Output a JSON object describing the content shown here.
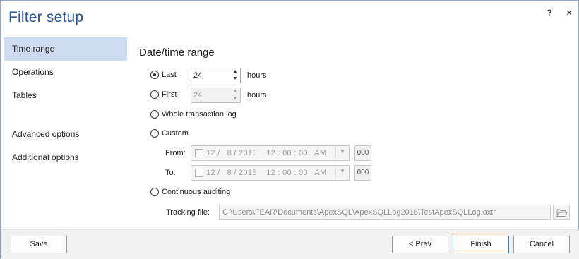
{
  "window": {
    "title": "Filter setup",
    "help_label": "?",
    "close_label": "×"
  },
  "sidebar": {
    "items": [
      {
        "label": "Time range",
        "active": true
      },
      {
        "label": "Operations"
      },
      {
        "label": "Tables"
      },
      {
        "label": "Advanced options"
      },
      {
        "label": "Additional options"
      }
    ]
  },
  "main": {
    "section_title": "Date/time range",
    "last": {
      "label": "Last",
      "value": "24",
      "unit": "hours",
      "selected": true
    },
    "first": {
      "label": "First",
      "value": "24",
      "unit": "hours",
      "selected": false
    },
    "whole": {
      "label": "Whole transaction log",
      "selected": false
    },
    "custom": {
      "label": "Custom",
      "selected": false,
      "from_label": "From:",
      "from_value": "12 /   8 / 2015    12 : 00 : 00   AM",
      "from_ms": "000",
      "to_label": "To:",
      "to_value": "12 /   8 / 2015    12 : 00 : 00   AM",
      "to_ms": "000"
    },
    "continuous": {
      "label": "Continuous auditing",
      "selected": false,
      "tracking_label": "Tracking file:",
      "tracking_value": "C:\\Users\\FEAR\\Documents\\ApexSQL\\ApexSQLLog2016\\TestApexSQLLog.axtr"
    }
  },
  "footer": {
    "save_label": "Save",
    "prev_label": "< Prev",
    "finish_label": "Finish",
    "cancel_label": "Cancel"
  },
  "colors": {
    "title": "#2b5797",
    "sidebar_active": "#cddcf0",
    "footer_bg": "#f0f0f0",
    "primary_border": "#3c7fb1"
  }
}
